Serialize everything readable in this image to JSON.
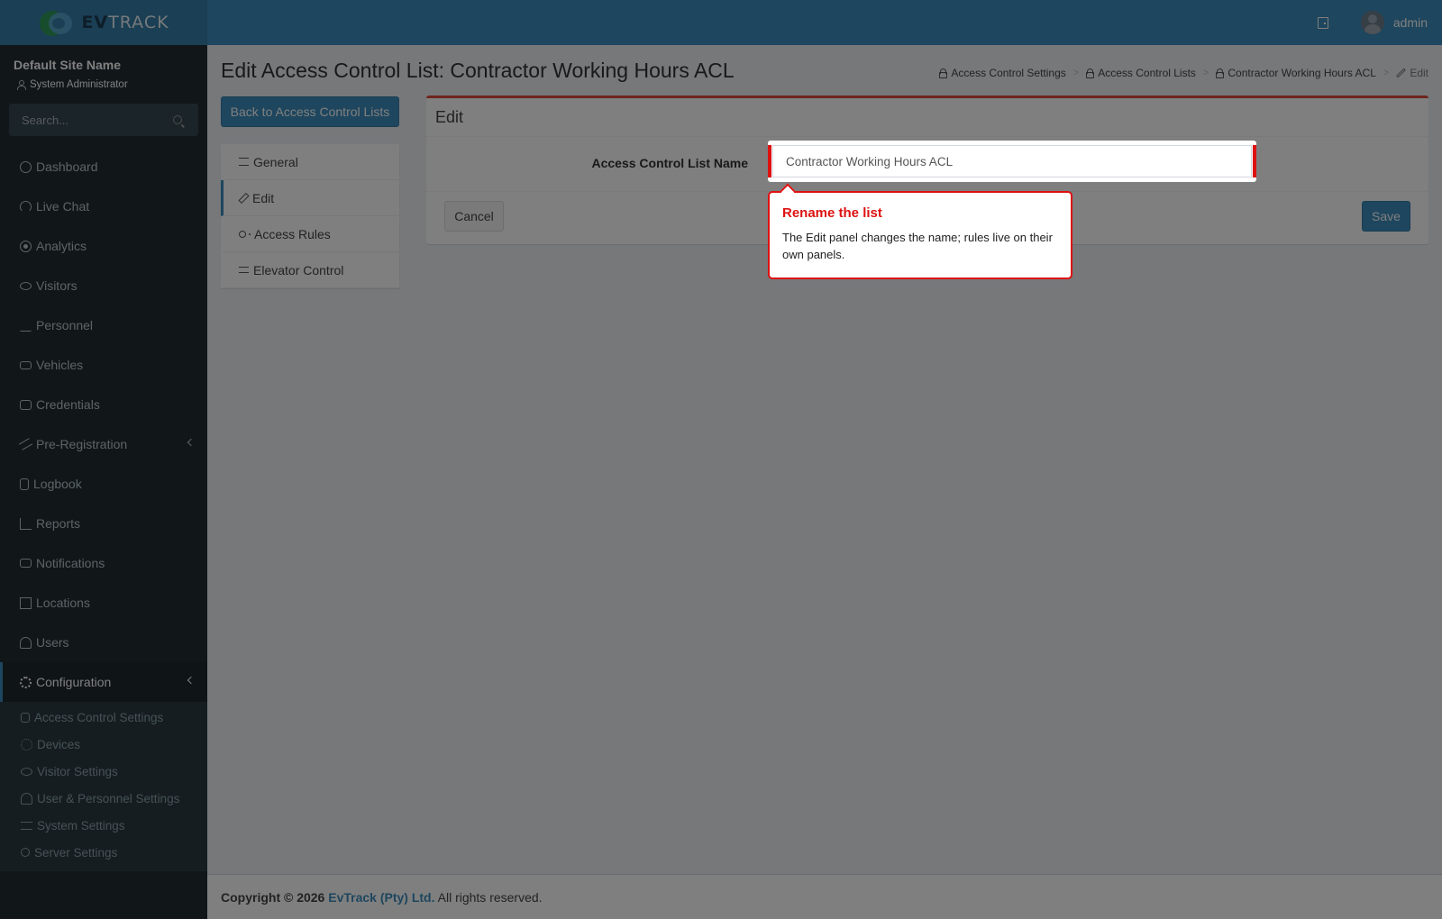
{
  "header": {
    "logo_ev": "EV",
    "logo_track": "TRACK",
    "user_name": "admin"
  },
  "sidebar": {
    "site_name": "Default Site Name",
    "user_role": "System Administrator",
    "search_placeholder": "Search...",
    "items": [
      {
        "label": "Dashboard",
        "icon": "dashboard-icon"
      },
      {
        "label": "Live Chat",
        "icon": "headset-icon"
      },
      {
        "label": "Analytics",
        "icon": "target-icon"
      },
      {
        "label": "Visitors",
        "icon": "eye-icon"
      },
      {
        "label": "Personnel",
        "icon": "users-icon"
      },
      {
        "label": "Vehicles",
        "icon": "car-icon"
      },
      {
        "label": "Credentials",
        "icon": "id-card-icon"
      },
      {
        "label": "Pre-Registration",
        "icon": "arrows-icon"
      },
      {
        "label": "Logbook",
        "icon": "book-icon"
      },
      {
        "label": "Reports",
        "icon": "chart-icon"
      },
      {
        "label": "Notifications",
        "icon": "chat-icon"
      },
      {
        "label": "Locations",
        "icon": "map-icon"
      },
      {
        "label": "Users",
        "icon": "user-cog-icon"
      },
      {
        "label": "Configuration",
        "icon": "gear-icon"
      }
    ],
    "submenu": [
      {
        "label": "Access Control Settings",
        "icon": "lock-icon"
      },
      {
        "label": "Devices",
        "icon": "device-icon"
      },
      {
        "label": "Visitor Settings",
        "icon": "eye-icon"
      },
      {
        "label": "User & Personnel Settings",
        "icon": "user-cog-icon"
      },
      {
        "label": "System Settings",
        "icon": "sliders-icon"
      },
      {
        "label": "Server Settings",
        "icon": "server-icon"
      }
    ]
  },
  "page": {
    "title": "Edit Access Control List: Contractor Working Hours ACL",
    "breadcrumb": [
      "Access Control Settings",
      "Access Control Lists",
      "Contractor Working Hours ACL",
      "Edit"
    ],
    "back_button": "Back to Access Control Lists",
    "nav": [
      {
        "label": "General",
        "icon": "list-icon"
      },
      {
        "label": "Edit",
        "icon": "pencil-icon"
      },
      {
        "label": "Access Rules",
        "icon": "key-icon"
      },
      {
        "label": "Elevator Control",
        "icon": "bars-icon"
      }
    ]
  },
  "edit_box": {
    "title": "Edit",
    "field_label": "Access Control List Name",
    "field_value": "Contractor Working Hours ACL",
    "cancel_label": "Cancel",
    "save_label": "Save"
  },
  "tooltip": {
    "title": "Rename the list",
    "body": "The Edit panel changes the name; rules live on their own panels."
  },
  "footer": {
    "copyright": "Copyright © 2026",
    "company": "EvTrack (Pty) Ltd.",
    "rights": "All rights reserved."
  },
  "colors": {
    "header": "#3c8dbc",
    "sidebar": "#222d32",
    "highlight": "#dd1111",
    "box_top": "#dd4b39"
  }
}
